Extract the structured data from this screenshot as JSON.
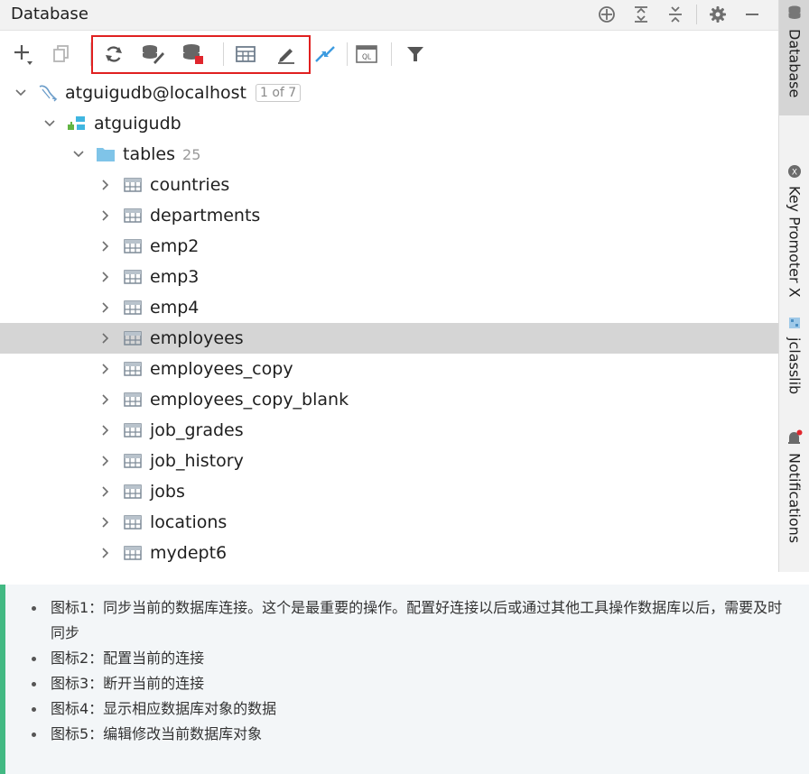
{
  "panel": {
    "title": "Database",
    "header_icons": [
      "crosshair-icon",
      "expand-all-icon",
      "collapse-all-icon",
      "gear-icon",
      "minimize-icon"
    ]
  },
  "toolbar": {
    "items": [
      "add-icon",
      "duplicate-icon",
      "refresh-icon",
      "data-source-properties-icon",
      "disconnect-icon",
      "table-view-icon",
      "edit-icon",
      "jump-to-console-icon",
      "query-console-icon",
      "filter-icon"
    ],
    "highlight_color": "#e02020"
  },
  "tree": {
    "connection": {
      "label": "atguigudb@localhost",
      "badge": "1 of 7"
    },
    "schema": {
      "label": "atguigudb"
    },
    "tables": {
      "label": "tables",
      "count": "25"
    },
    "items": [
      "countries",
      "departments",
      "emp2",
      "emp3",
      "emp4",
      "employees",
      "employees_copy",
      "employees_copy_blank",
      "job_grades",
      "job_history",
      "jobs",
      "locations",
      "mydept6"
    ],
    "selected_index": 5
  },
  "side_strip": {
    "tabs": [
      {
        "label": "Database",
        "icon": "database-icon"
      },
      {
        "label": "Key Promoter X",
        "icon": "key-promoter-icon"
      },
      {
        "label": "jclasslib",
        "icon": "jclasslib-icon"
      },
      {
        "label": "Notifications",
        "icon": "bell-icon"
      }
    ]
  },
  "notes": {
    "accent_color": "#42b983",
    "items": [
      "图标1：同步当前的数据库连接。这个是最重要的操作。配置好连接以后或通过其他工具操作数据库以后，需要及时同步",
      "图标2：配置当前的连接",
      "图标3：断开当前的连接",
      "图标4：显示相应数据库对象的数据",
      "图标5：编辑修改当前数据库对象"
    ]
  }
}
